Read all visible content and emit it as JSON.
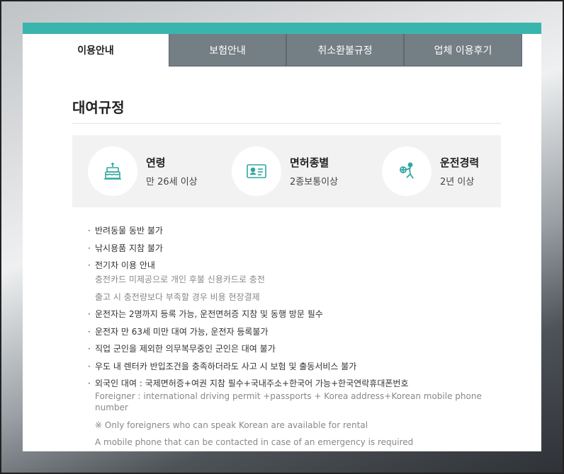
{
  "tabs": [
    {
      "label": "이용안내",
      "active": true
    },
    {
      "label": "보험안내",
      "active": false
    },
    {
      "label": "취소환불규정",
      "active": false
    },
    {
      "label": "업체 이용후기",
      "active": false
    }
  ],
  "section_title": "대여규정",
  "info": {
    "age": {
      "label": "연령",
      "value": "만 26세 이상",
      "icon": "cake-icon"
    },
    "license": {
      "label": "면허종별",
      "value": "2종보통이상",
      "icon": "id-card-icon"
    },
    "career": {
      "label": "운전경력",
      "value": "2년 이상",
      "icon": "driver-icon"
    }
  },
  "rules": {
    "r1": "반려동물 동반 불가",
    "r2": "낚시용품 지참 불가",
    "r3": "전기차 이용 안내",
    "r3_sub1": "충전카드 미제공으로 개인 후불 신용카드로 충전",
    "r3_sub2": "출고 시 충전량보다 부족할 경우 비용 현장결제",
    "r4": "운전자는 2명까지 등록 가능, 운전면허증 지참 및 동행 방문 필수",
    "r5": "운전자 만 63세 미만 대여 가능, 운전자 등록불가",
    "r6": "직업 군인을 제외한 의무복무중인 군인은 대여 불가",
    "r7": "우도 내 렌터카 반입조건을 충족하더라도 사고 시 보험 및 출동서비스 불가",
    "r8": "외국인 대여 : 국제면허증+여권 지참 필수+국내주소+한국어 가능+한국연락휴대폰번호",
    "r8_sub1": "Foreigner : international driving permit +passports + Korea address+Korean mobile phone number",
    "r8_sub2": "※ Only foreigners who can speak Korean are available for rental",
    "r8_sub3": "A mobile phone that can be contacted in case of an emergency is required"
  },
  "colors": {
    "accent": "#39b5ad",
    "tab_inactive": "#747e85"
  }
}
